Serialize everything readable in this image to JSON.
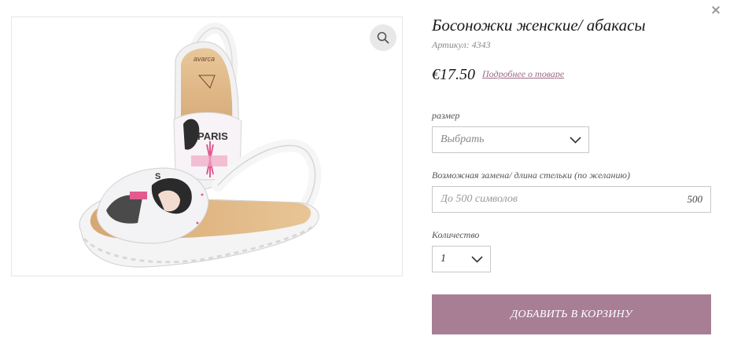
{
  "product": {
    "title": "Босоножки женские/ абакасы",
    "sku": "Артикул: 4343",
    "price": "€17.50",
    "details_link": "Подробнее о товаре",
    "brand_on_insole": "avarca",
    "print_text": "PARIS"
  },
  "size": {
    "label": "размер",
    "selected": "Выбрать"
  },
  "insole": {
    "label": "Возможная замена/ длина стельки (по желанию)",
    "value": "",
    "placeholder": "До 500 символов",
    "counter": "500"
  },
  "quantity": {
    "label": "Количество",
    "selected": "1"
  },
  "actions": {
    "add_to_cart": "ДОБАВИТЬ В КОРЗИНУ",
    "close": "×"
  },
  "icons": {
    "close": "close-icon",
    "zoom": "magnifier-icon",
    "dropdown": "chevron-down-icon"
  },
  "colors": {
    "accent": "#a87e94",
    "link": "#9b6a85",
    "zoom_bg": "#e8e8e8",
    "border": "#c8c8c8"
  }
}
